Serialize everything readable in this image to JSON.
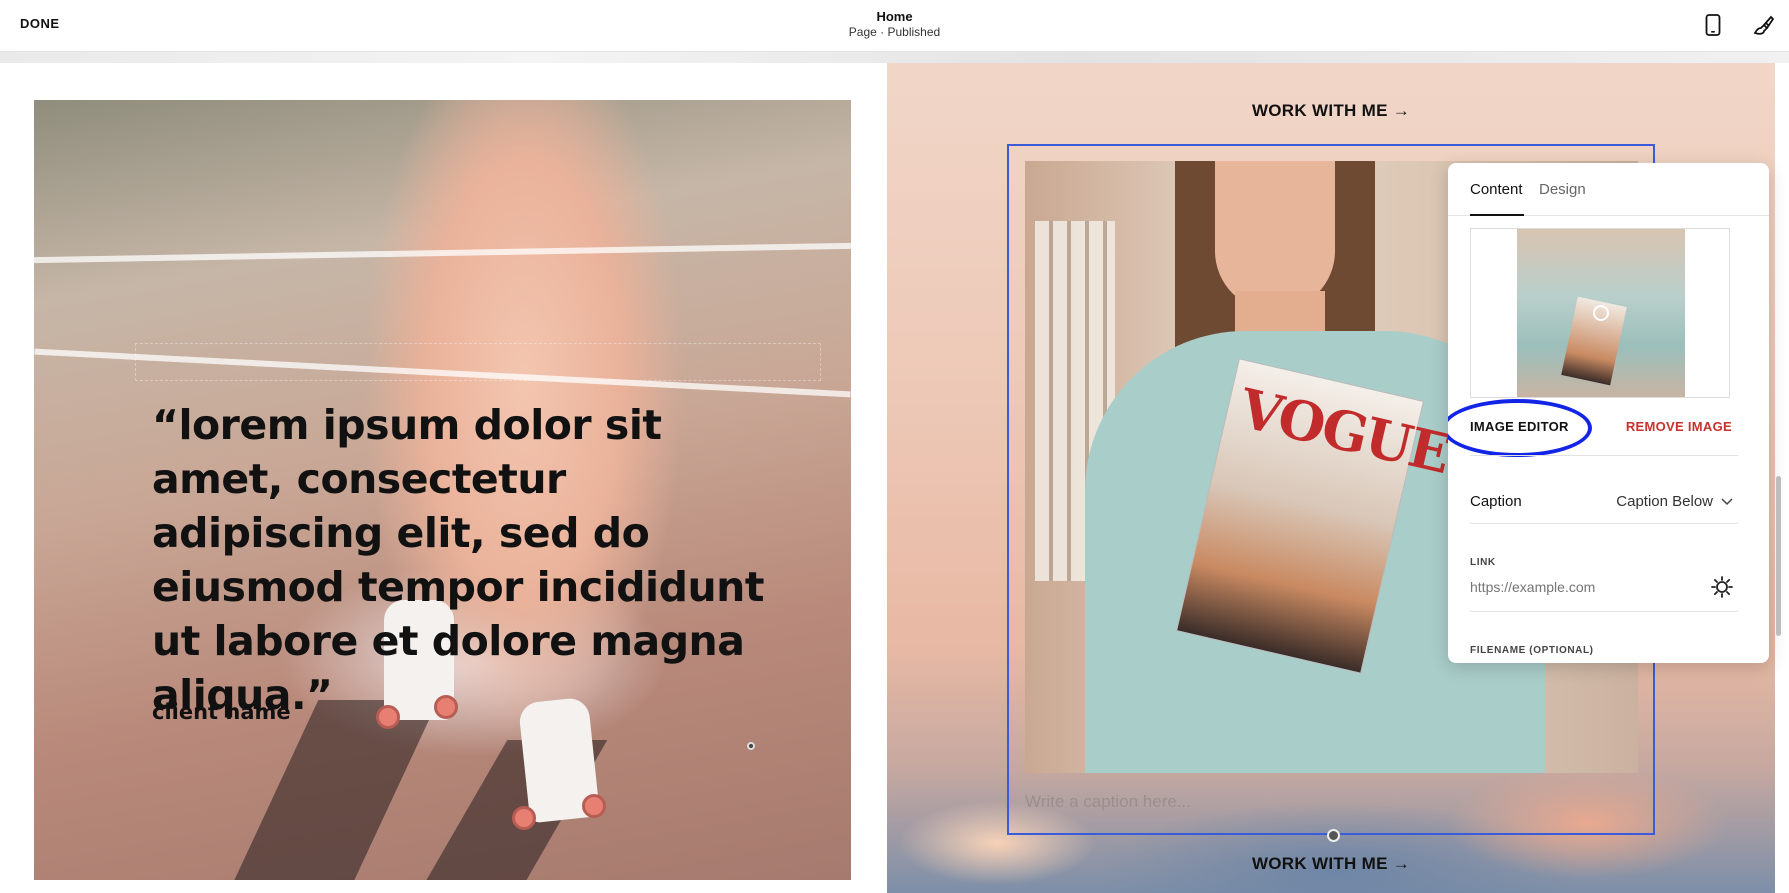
{
  "topbar": {
    "done_label": "DONE",
    "page_title": "Home",
    "page_status": "Page · Published",
    "icons": {
      "mobile": "mobile-preview-icon",
      "brush": "site-styles-brush-icon"
    }
  },
  "left_section": {
    "quote": "“lorem ipsum dolor sit amet, consectetur adipiscing elit, sed do eiusmod tempor incididunt ut labore et dolore magna aliqua.”",
    "client_name": "client name"
  },
  "right_section": {
    "link_top": "WORK WITH ME →",
    "link_bottom": "WORK WITH ME →",
    "magazine_title": "VOGUE",
    "caption_placeholder": "Write a caption here...",
    "selection_color": "#3b5bdb"
  },
  "panel": {
    "tabs": [
      {
        "label": "Content",
        "active": true
      },
      {
        "label": "Design",
        "active": false
      }
    ],
    "image_editor_label": "IMAGE EDITOR",
    "remove_image_label": "REMOVE IMAGE",
    "caption_label": "Caption",
    "caption_value": "Caption Below",
    "link_label": "LINK",
    "link_placeholder": "https://example.com",
    "filename_label": "FILENAME (OPTIONAL)",
    "remove_color": "#c8322e",
    "highlight_ring_color": "#1225e6"
  }
}
